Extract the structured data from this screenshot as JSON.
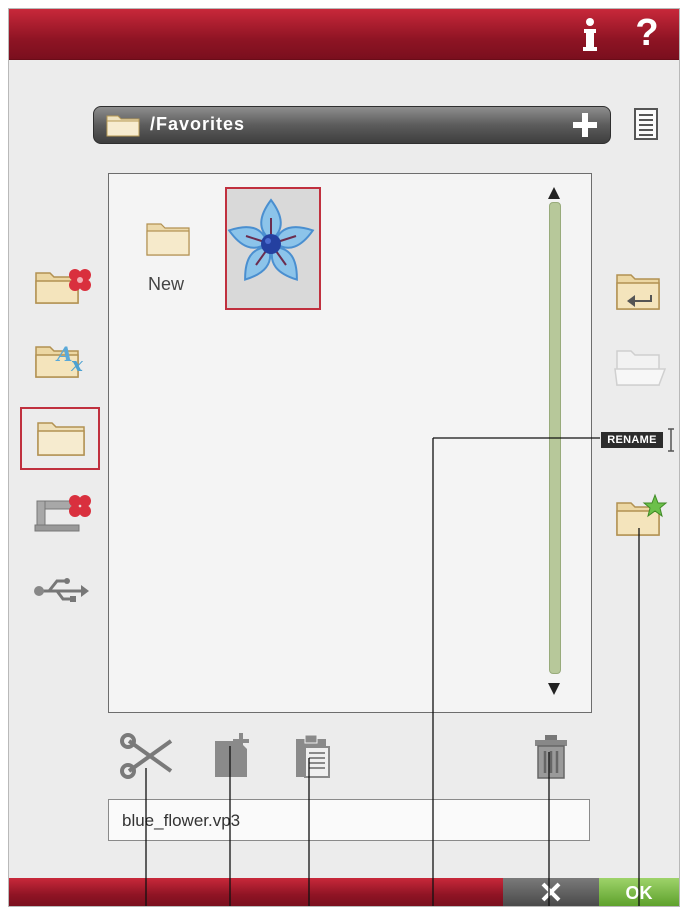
{
  "header": {
    "info_icon": "info-icon",
    "help_label": "?"
  },
  "path_bar": {
    "path": "/Favorites",
    "folder_icon": "folder-icon",
    "add_icon": "plus-icon"
  },
  "list_view_icon": "list-view-icon",
  "file_browser": {
    "items": [
      {
        "name": "New",
        "type": "folder"
      },
      {
        "name": "",
        "type": "embroidery-design",
        "selected": true
      }
    ]
  },
  "sidebar_left": [
    {
      "icon": "embroidery-designs-folder-icon"
    },
    {
      "icon": "fonts-folder-icon"
    },
    {
      "icon": "personal-folder-icon",
      "selected": true
    },
    {
      "icon": "machine-folder-icon"
    },
    {
      "icon": "usb-icon"
    }
  ],
  "sidebar_right": [
    {
      "icon": "folder-up-icon"
    },
    {
      "icon": "open-folder-icon",
      "disabled": true
    },
    {
      "label": "RENAME",
      "icon": "text-cursor-icon"
    },
    {
      "icon": "favorite-folder-icon"
    }
  ],
  "toolbar": {
    "cut_icon": "scissors-icon",
    "new_folder_icon": "new-file-icon",
    "paste_icon": "clipboard-icon",
    "delete_icon": "trash-icon"
  },
  "filename": "blue_flower.vp3",
  "footer": {
    "cancel_icon": "cancel-icon",
    "ok_label": "OK"
  },
  "colors": {
    "header_red": "#8f1424",
    "selection_red": "#c0303e",
    "ok_green": "#5ea12c",
    "folder_tan": "#e9d4a0",
    "scroll_green": "#b7c89a"
  }
}
